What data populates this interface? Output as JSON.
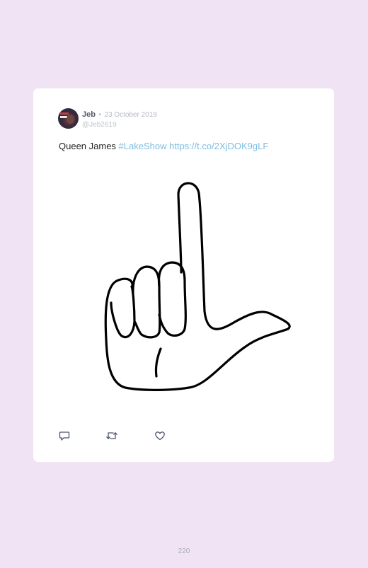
{
  "tweet": {
    "author_name": "Jeb",
    "separator": "•",
    "date": "23 October 2019",
    "handle": "@Jeb2619",
    "text_prefix": "Queen James ",
    "hashtag": "#LakeShow",
    "link": "https://t.co/2XjDOK9gLF",
    "media_icon": "hand-l-gesture-icon",
    "actions": [
      {
        "name": "reply",
        "icon": "comment-icon"
      },
      {
        "name": "retweet",
        "icon": "retweet-icon"
      },
      {
        "name": "like",
        "icon": "heart-icon"
      }
    ]
  },
  "page": {
    "number": "220"
  },
  "colors": {
    "background": "#f0e4f4",
    "card": "#ffffff",
    "link": "#7fbde0",
    "muted": "#b6bac4"
  }
}
